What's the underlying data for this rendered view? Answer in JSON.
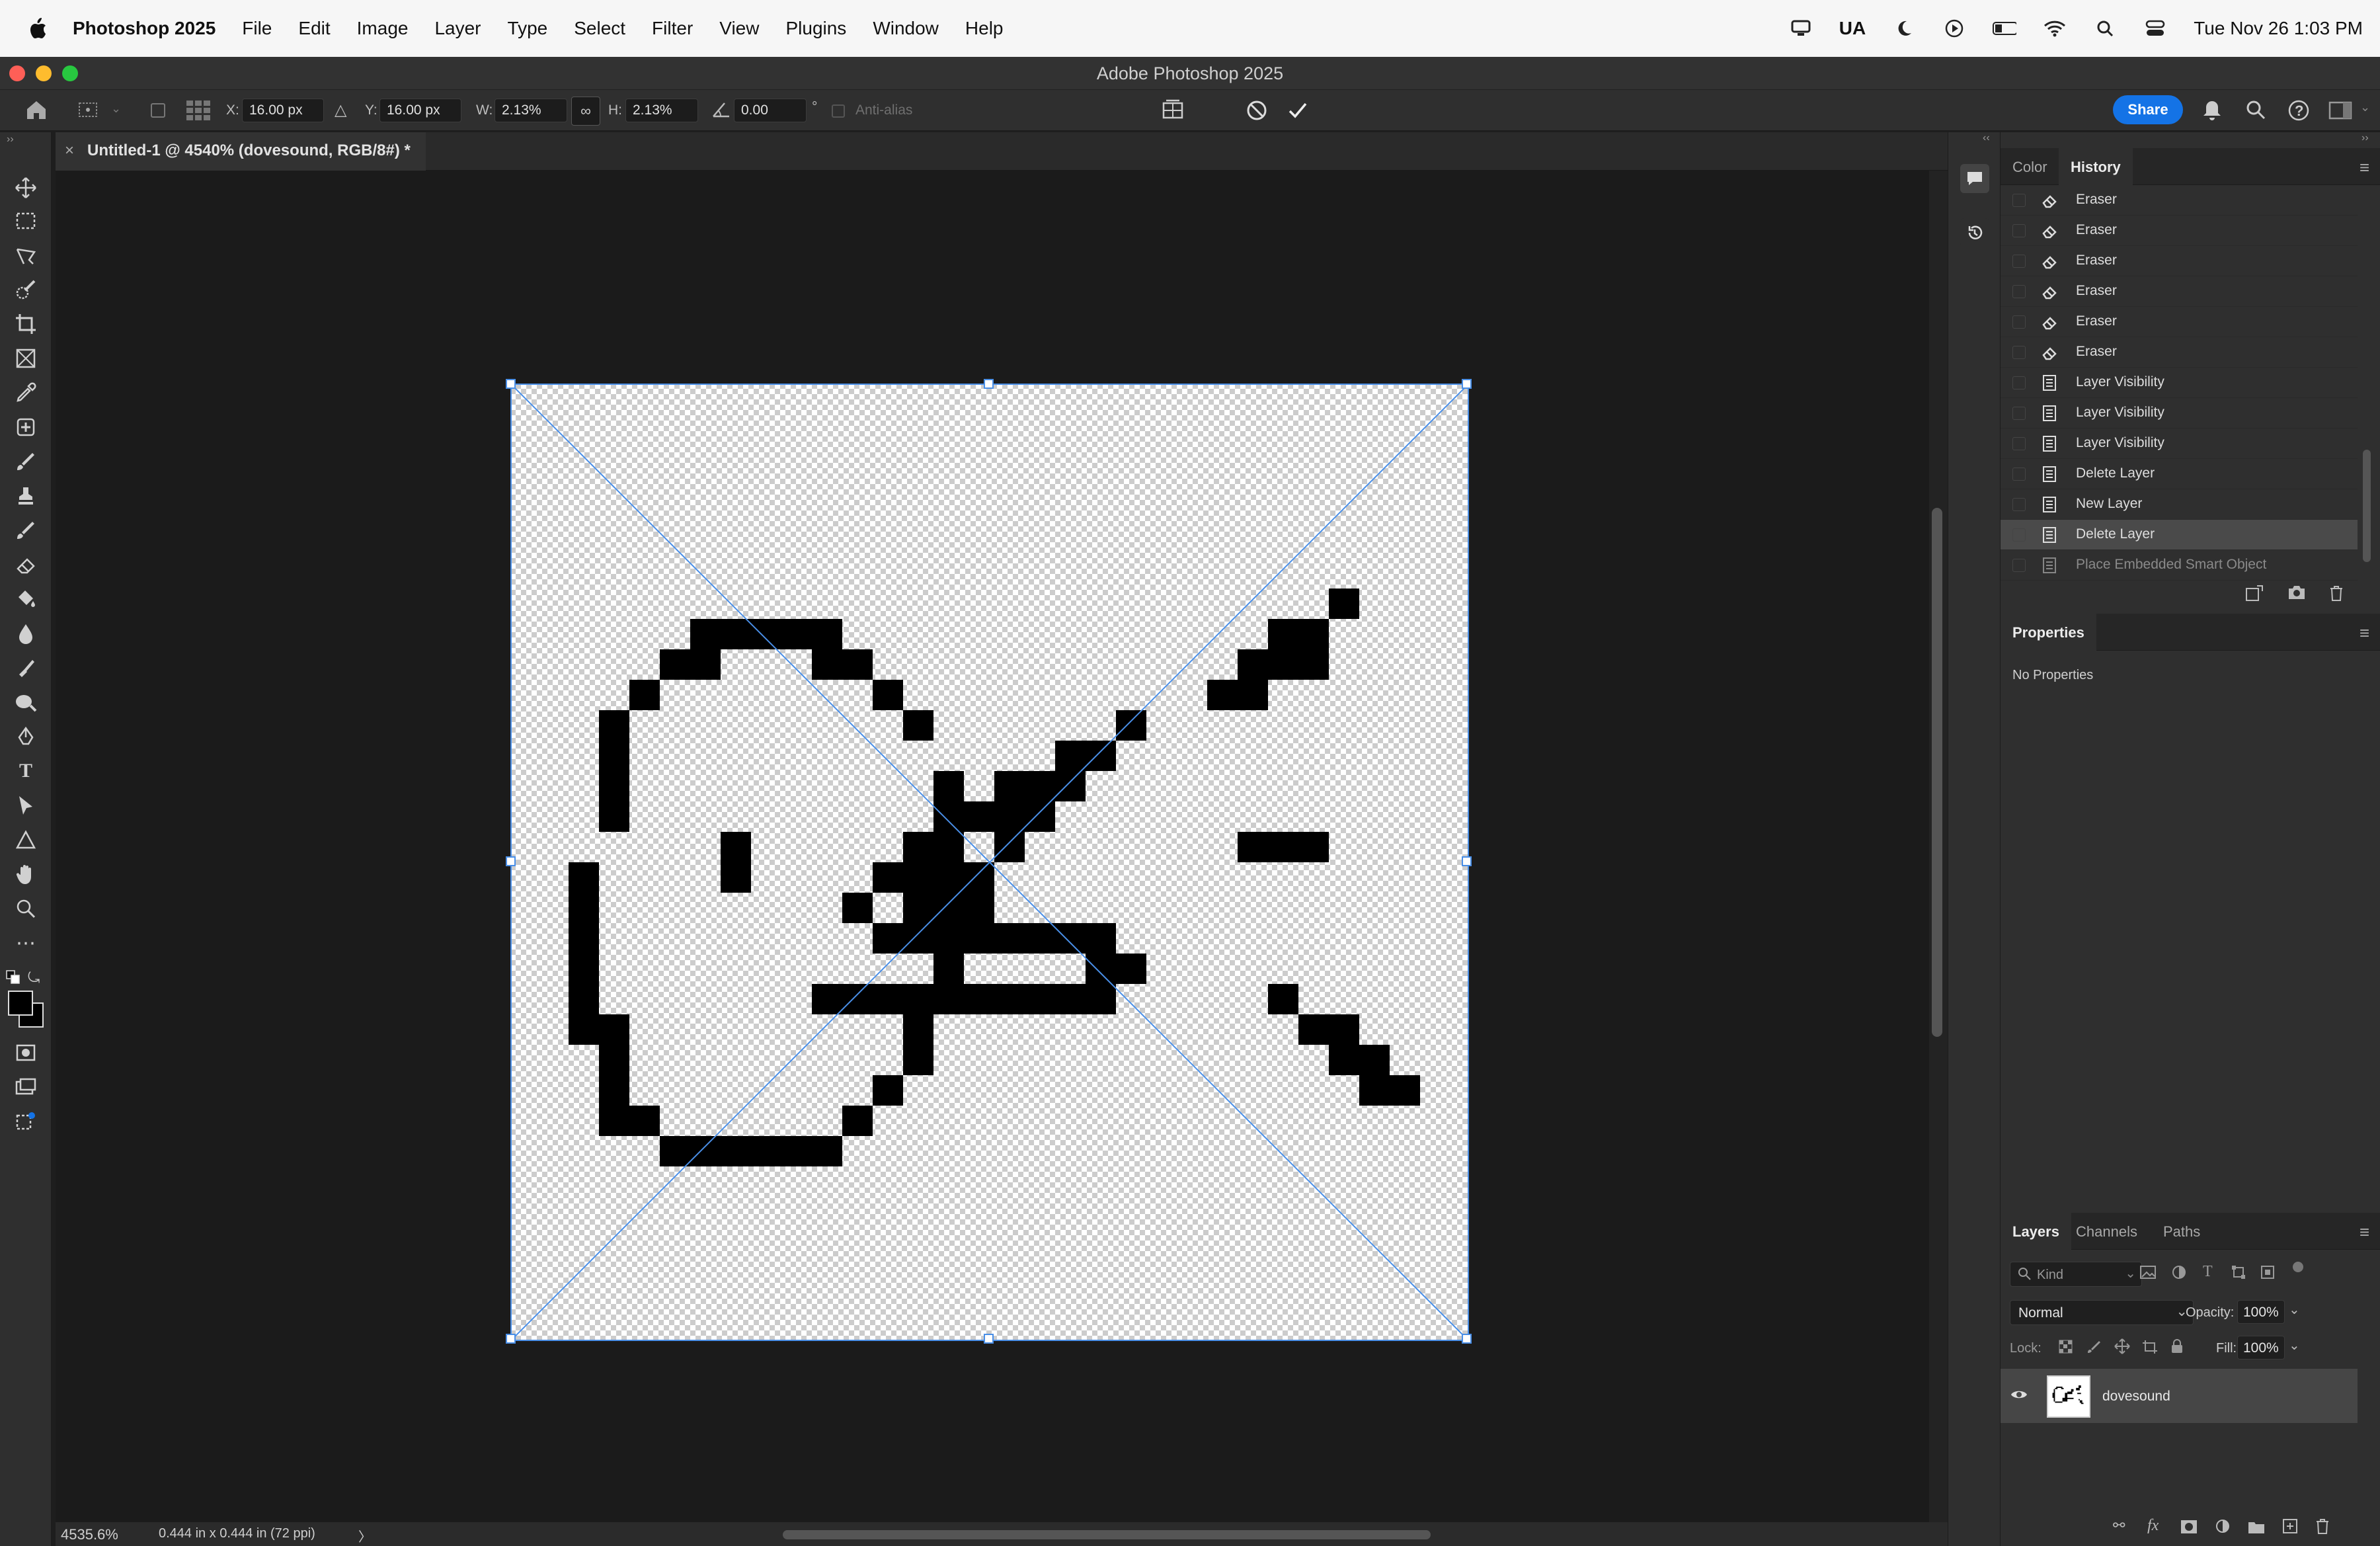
{
  "menubar": {
    "app": "Photoshop 2025",
    "items": [
      "File",
      "Edit",
      "Image",
      "Layer",
      "Type",
      "Select",
      "Filter",
      "View",
      "Plugins",
      "Window",
      "Help"
    ],
    "input_source": "UA",
    "datetime": "Tue Nov 26  1:03 PM"
  },
  "window": {
    "title": "Adobe Photoshop 2025"
  },
  "options": {
    "x_label": "X:",
    "x_value": "16.00 px",
    "y_label": "Y:",
    "y_value": "16.00 px",
    "w_label": "W:",
    "w_value": "2.13%",
    "h_label": "H:",
    "h_value": "2.13%",
    "angle_value": "0.00",
    "degree": "°",
    "antialias": "Anti-alias",
    "share": "Share"
  },
  "document": {
    "tab_title": "Untitled-1 @ 4540% (dovesound, RGB/8#) *"
  },
  "status": {
    "zoom": "4535.6%",
    "doc_size": "0.444 in x 0.444 in (72 ppi)",
    "arrow": "〉"
  },
  "history": {
    "tabs": [
      "Color",
      "History"
    ],
    "active_tab": "History",
    "items": [
      {
        "icon": "eraser-icon",
        "label": "Eraser"
      },
      {
        "icon": "eraser-icon",
        "label": "Eraser"
      },
      {
        "icon": "eraser-icon",
        "label": "Eraser"
      },
      {
        "icon": "eraser-icon",
        "label": "Eraser"
      },
      {
        "icon": "eraser-icon",
        "label": "Eraser"
      },
      {
        "icon": "eraser-icon",
        "label": "Eraser"
      },
      {
        "icon": "document-icon",
        "label": "Layer Visibility"
      },
      {
        "icon": "document-icon",
        "label": "Layer Visibility"
      },
      {
        "icon": "document-icon",
        "label": "Layer Visibility"
      },
      {
        "icon": "document-icon",
        "label": "Delete Layer"
      },
      {
        "icon": "document-icon",
        "label": "New Layer"
      },
      {
        "icon": "document-icon",
        "label": "Delete Layer",
        "selected": true
      },
      {
        "icon": "document-icon",
        "label": "Place Embedded Smart Object",
        "dimmed": true
      }
    ]
  },
  "properties": {
    "title": "Properties",
    "empty_text": "No Properties"
  },
  "layers": {
    "tabs": [
      "Layers",
      "Channels",
      "Paths"
    ],
    "kind_placeholder": "Kind",
    "blend_mode": "Normal",
    "opacity_label": "Opacity:",
    "opacity": "100%",
    "lock_label": "Lock:",
    "fill_label": "Fill:",
    "fill": "100%",
    "items": [
      {
        "name": "dovesound",
        "visible": true
      }
    ]
  },
  "colors": {
    "accent": "#1473e6",
    "selection": "#4a8fe7"
  }
}
